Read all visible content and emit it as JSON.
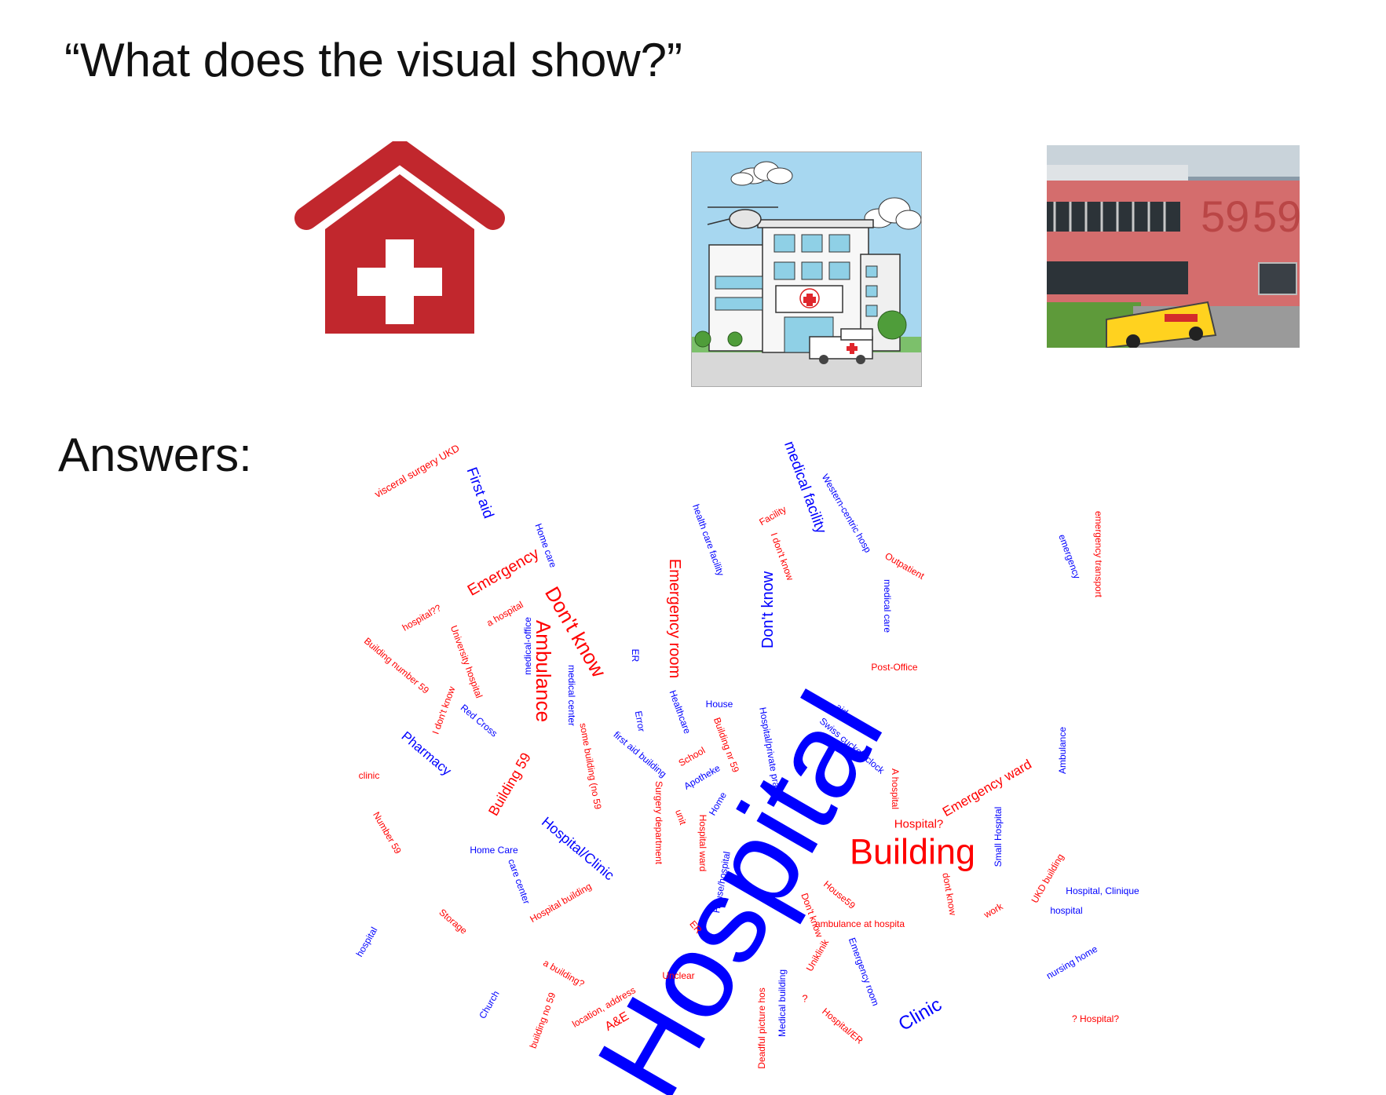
{
  "question": "“What does the visual show?”",
  "answers_heading": "Answers:",
  "images": [
    {
      "name": "medical-house-icon",
      "color": "#c1272d"
    },
    {
      "name": "hospital-cartoon-illustration"
    },
    {
      "name": "building-59-photo",
      "building_number": "59"
    }
  ],
  "word_cloud": {
    "colors": {
      "red": "#ff0000",
      "blue": "#0000ff"
    },
    "words": [
      {
        "text": "visceral surgery UKD",
        "color": "red"
      },
      {
        "text": "First aid",
        "color": "blue"
      },
      {
        "text": "Home care",
        "color": "blue"
      },
      {
        "text": "Emergency",
        "color": "red"
      },
      {
        "text": "a hospital",
        "color": "red"
      },
      {
        "text": "hospital??",
        "color": "red"
      },
      {
        "text": "University hospital",
        "color": "red"
      },
      {
        "text": "Building number 59",
        "color": "red"
      },
      {
        "text": "medical-office",
        "color": "blue"
      },
      {
        "text": "Don't know",
        "color": "red"
      },
      {
        "text": "Ambulance",
        "color": "red"
      },
      {
        "text": "medical center",
        "color": "blue"
      },
      {
        "text": "Emergency room",
        "color": "red"
      },
      {
        "text": "health care facility",
        "color": "blue"
      },
      {
        "text": "medical facility",
        "color": "blue"
      },
      {
        "text": "Facility",
        "color": "red"
      },
      {
        "text": "I don't know",
        "color": "red"
      },
      {
        "text": "Western-centric hosp",
        "color": "blue"
      },
      {
        "text": "Outpatient",
        "color": "red"
      },
      {
        "text": "medical care",
        "color": "blue"
      },
      {
        "text": "Don't know",
        "color": "blue"
      },
      {
        "text": "emergency",
        "color": "blue"
      },
      {
        "text": "emergency transport",
        "color": "red"
      },
      {
        "text": "Post-Office",
        "color": "red"
      },
      {
        "text": "ER",
        "color": "blue"
      },
      {
        "text": "I don't know",
        "color": "red"
      },
      {
        "text": "Red Cross",
        "color": "blue"
      },
      {
        "text": "Pharmacy",
        "color": "blue"
      },
      {
        "text": "clinic",
        "color": "red"
      },
      {
        "text": "Building 59",
        "color": "red"
      },
      {
        "text": "some building (no 59",
        "color": "red"
      },
      {
        "text": "Error",
        "color": "blue"
      },
      {
        "text": "first aid building",
        "color": "blue"
      },
      {
        "text": "Healthcare",
        "color": "blue"
      },
      {
        "text": "House",
        "color": "blue"
      },
      {
        "text": "Building nr 59",
        "color": "red"
      },
      {
        "text": "Hospital/private pra",
        "color": "blue"
      },
      {
        "text": "aid",
        "color": "blue"
      },
      {
        "text": "Swiss cuckoo clock",
        "color": "blue"
      },
      {
        "text": "School",
        "color": "red"
      },
      {
        "text": "Apotheke",
        "color": "blue"
      },
      {
        "text": "Home",
        "color": "blue"
      },
      {
        "text": "A hospital",
        "color": "red"
      },
      {
        "text": "Emergency ward",
        "color": "red"
      },
      {
        "text": "Ambulance",
        "color": "blue"
      },
      {
        "text": "Number 59",
        "color": "red"
      },
      {
        "text": "Home Care",
        "color": "blue"
      },
      {
        "text": "Hospital/Clinic",
        "color": "blue"
      },
      {
        "text": "Surgery department",
        "color": "red"
      },
      {
        "text": "unit",
        "color": "red"
      },
      {
        "text": "Hospital ward",
        "color": "red"
      },
      {
        "text": "Hospital",
        "color": "blue"
      },
      {
        "text": "Hospital?",
        "color": "red"
      },
      {
        "text": "Building",
        "color": "red"
      },
      {
        "text": "Small Hospital",
        "color": "blue"
      },
      {
        "text": "care center",
        "color": "blue"
      },
      {
        "text": "Hospital building",
        "color": "red"
      },
      {
        "text": "House/hospital",
        "color": "blue"
      },
      {
        "text": "House59",
        "color": "red"
      },
      {
        "text": "dont know",
        "color": "red"
      },
      {
        "text": "UKD building",
        "color": "red"
      },
      {
        "text": "Hospital, Clinique",
        "color": "blue"
      },
      {
        "text": "hospital",
        "color": "blue"
      },
      {
        "text": "Storage",
        "color": "red"
      },
      {
        "text": "hospital",
        "color": "blue"
      },
      {
        "text": "work",
        "color": "red"
      },
      {
        "text": "Don't know",
        "color": "red"
      },
      {
        "text": "ambulance at hospita",
        "color": "red"
      },
      {
        "text": "ER",
        "color": "red"
      },
      {
        "text": "Uniklinik",
        "color": "red"
      },
      {
        "text": "Emergency room",
        "color": "blue"
      },
      {
        "text": "nursing home",
        "color": "blue"
      },
      {
        "text": "a building?",
        "color": "red"
      },
      {
        "text": "Unclear",
        "color": "red"
      },
      {
        "text": "building no 59",
        "color": "red"
      },
      {
        "text": "location, address",
        "color": "red"
      },
      {
        "text": "Church",
        "color": "blue"
      },
      {
        "text": "A&E",
        "color": "red"
      },
      {
        "text": "Deadful picture hos",
        "color": "red"
      },
      {
        "text": "Medical building",
        "color": "blue"
      },
      {
        "text": "?",
        "color": "red"
      },
      {
        "text": "Hospital/ER",
        "color": "red"
      },
      {
        "text": "Clinic",
        "color": "blue"
      },
      {
        "text": "? Hospital?",
        "color": "red"
      }
    ]
  }
}
